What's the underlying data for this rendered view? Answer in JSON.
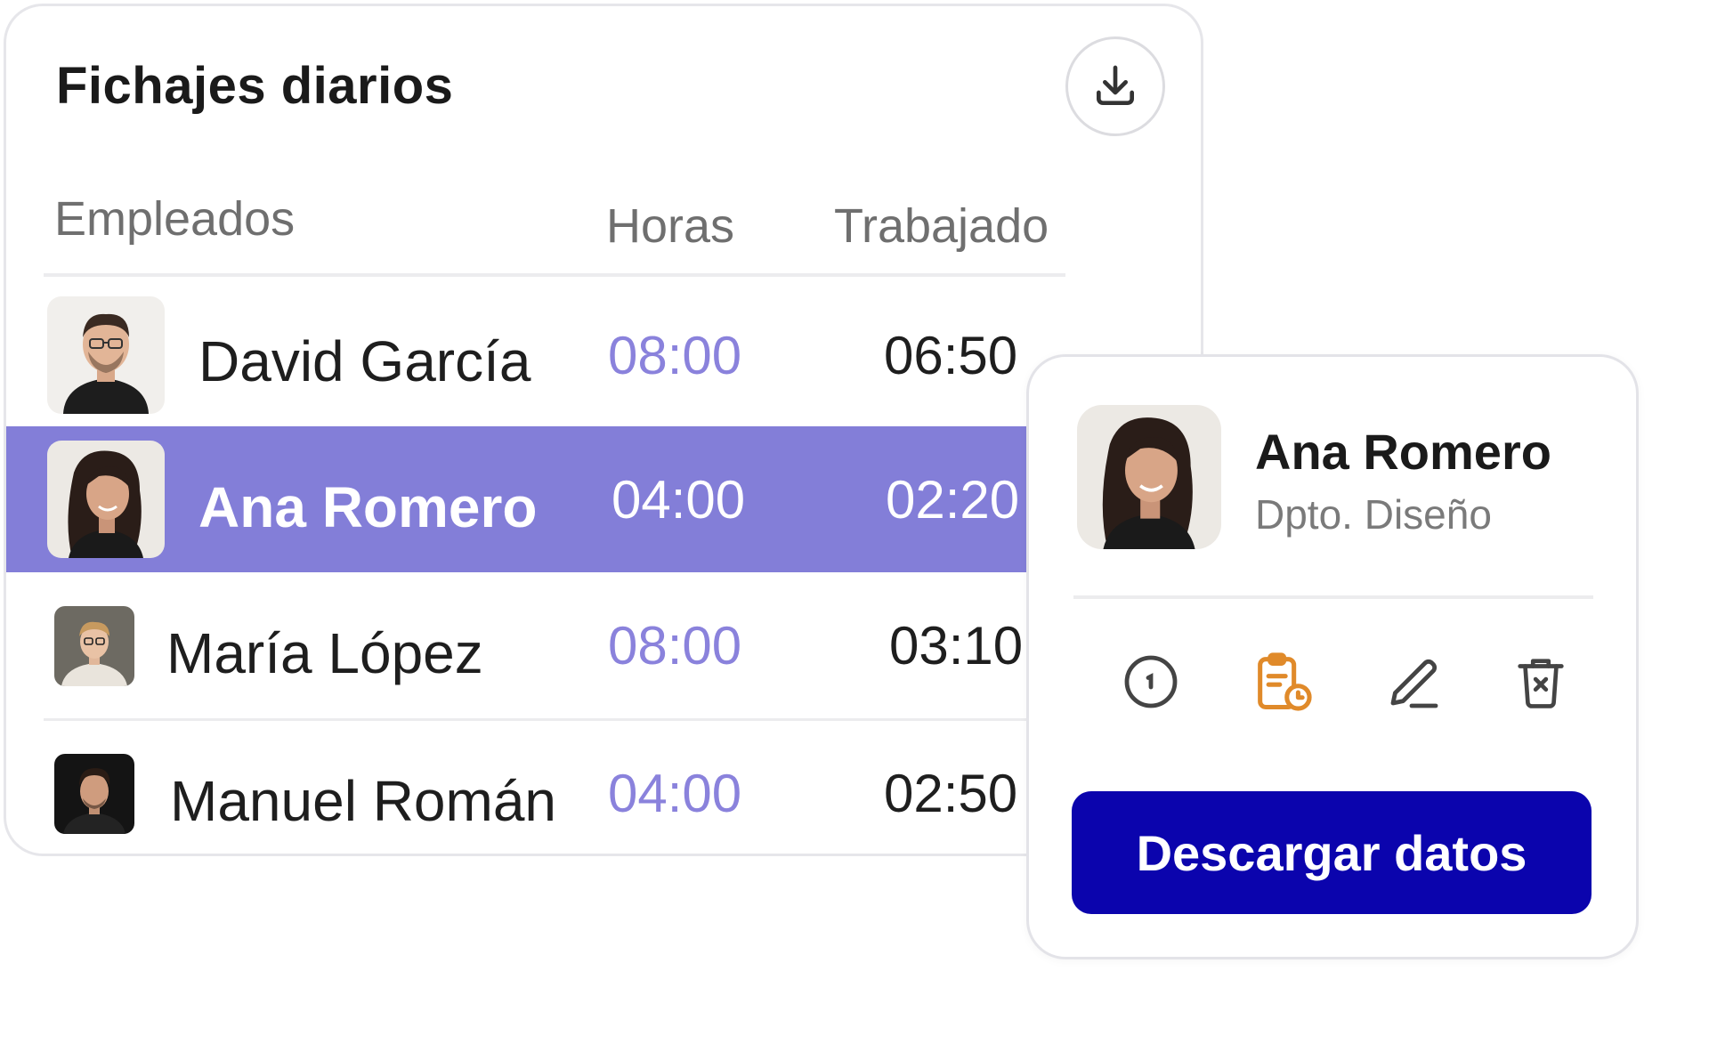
{
  "panel": {
    "title": "Fichajes diarios",
    "download_icon": "download-icon",
    "columns": {
      "employees": "Empleados",
      "hours": "Horas",
      "worked": "Trabajado"
    },
    "rows": [
      {
        "name": "David García",
        "hours": "08:00",
        "worked": "06:50",
        "selected": false
      },
      {
        "name": "Ana Romero",
        "hours": "04:00",
        "worked": "02:20",
        "selected": true
      },
      {
        "name": "María López",
        "hours": "08:00",
        "worked": "03:10",
        "selected": false
      },
      {
        "name": "Manuel Román",
        "hours": "04:00",
        "worked": "02:50",
        "selected": false
      }
    ]
  },
  "detail": {
    "name": "Ana Romero",
    "department": "Dpto. Diseño",
    "actions": [
      "clock-icon",
      "clipboard-clock-icon",
      "edit-pencil-icon",
      "trash-icon"
    ],
    "button_label": "Descargar datos"
  },
  "colors": {
    "selected_row": "#837ed8",
    "hours_text": "#8a82dc",
    "primary_button": "#0b04ad",
    "clipboard_accent": "#e08a2a"
  }
}
